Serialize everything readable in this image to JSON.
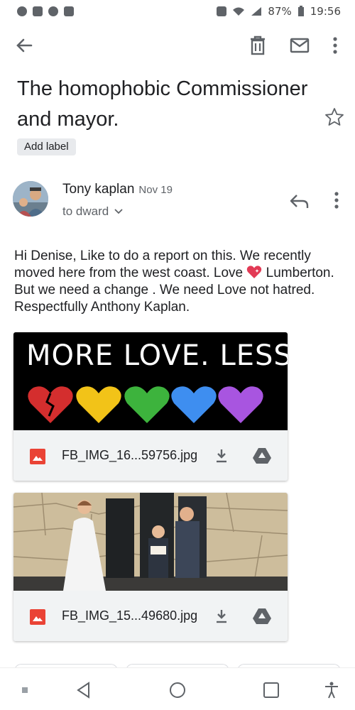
{
  "status_bar": {
    "battery": "87%",
    "time": "19:56"
  },
  "icons": {
    "back": "arrow-back-icon",
    "trash": "trash-icon",
    "mail": "mail-icon",
    "more": "more-vert-icon",
    "star": "star-outline-icon",
    "reply": "reply-icon",
    "download": "download-icon",
    "drive": "drive-icon",
    "image": "image-file-icon"
  },
  "email": {
    "subject": "The homophobic Commissioner and mayor.",
    "label_chip": "Add label",
    "sender": "Tony kaplan",
    "date": "Nov 19",
    "to": "to dward",
    "body_before_heart": "Hi Denise, Like to do a report on this. We recently moved here from the west coast. Love ",
    "body_after_heart": " Lumberton.  But we need a change . We need Love not hatred. Respectfully Anthony Kaplan."
  },
  "attachments": [
    {
      "image_text": "MORE LOVE. LESS HATE.",
      "filename": "FB_IMG_16...59756.jpg"
    },
    {
      "filename": "FB_IMG_15...49680.jpg"
    }
  ],
  "colors": {
    "accent_red": "#ea4335",
    "text": "#202124",
    "secondary": "#5f6368",
    "chip_bg": "#e8eaed",
    "attachment_bar": "#f1f3f4"
  }
}
